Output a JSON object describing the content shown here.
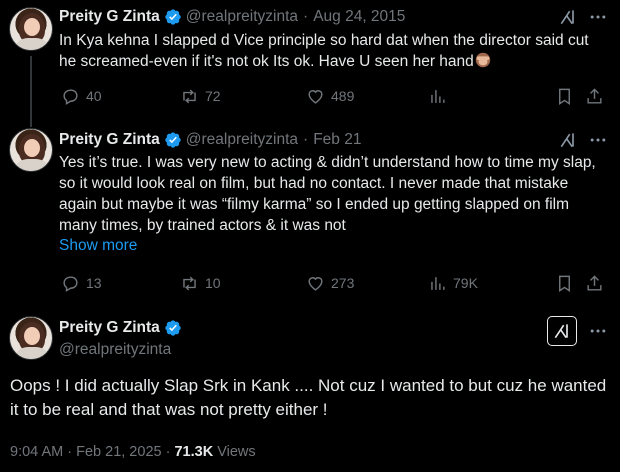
{
  "tweets": [
    {
      "name": "Preity G Zinta",
      "handle": "@realpreityzinta",
      "date": "Aug 24, 2015",
      "text": "In Kya kehna I slapped d Vice principle so hard dat when the director said cut he screamed-even if it's not ok Its ok. Have U seen her hand",
      "emoji": "see-no-evil-monkey",
      "replies": "40",
      "retweets": "72",
      "likes": "489",
      "views": ""
    },
    {
      "name": "Preity G Zinta",
      "handle": "@realpreityzinta",
      "date": "Feb 21",
      "text": "Yes it’s true. I was very new to acting & didn’t understand how to time my slap, so it would look real on film, but had no contact. I never made that mistake again but maybe it was “filmy karma” so I ended up getting slapped on film many times, by trained actors & it was not",
      "show_more": "Show more",
      "replies": "13",
      "retweets": "10",
      "likes": "273",
      "views": "79K"
    }
  ],
  "main_tweet": {
    "name": "Preity G Zinta",
    "handle": "@realpreityzinta",
    "text": "Oops ! I did actually Slap Srk in Kank .... Not cuz I wanted to but cuz he wanted it to be real and that was not pretty either !",
    "time": "9:04 AM",
    "separator": "·",
    "date": "Feb 21, 2025",
    "views_count": "71.3K",
    "views_label": "Views"
  },
  "colors": {
    "background": "#000000",
    "text": "#e7e9ea",
    "muted": "#71767b",
    "link": "#1d9bf0",
    "verified": "#1d9bf0"
  },
  "icons": [
    "verified-badge-icon",
    "grok-icon",
    "more-icon",
    "reply-icon",
    "retweet-icon",
    "like-icon",
    "views-icon",
    "bookmark-icon",
    "share-icon"
  ]
}
